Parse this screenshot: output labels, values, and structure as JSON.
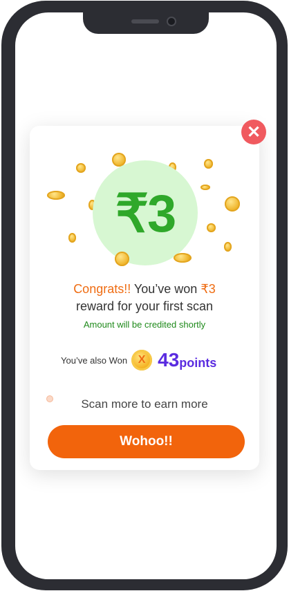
{
  "modal": {
    "hero_amount": "₹3",
    "headline_congrats": "Congrats!!",
    "headline_mid": " You’ve won ",
    "headline_amount": "₹3",
    "headline_line2": "reward for your first scan",
    "subtext": "Amount will be credited shortly",
    "also_won_label": "You’ve also Won",
    "points_coin_letter": "X",
    "points_value": "43",
    "points_unit": "points",
    "scan_more_text": "Scan more to earn more",
    "cta_label": "Wohoo!!",
    "close_glyph": "✕"
  },
  "icons": {
    "close": "close-icon",
    "coin": "coin-icon",
    "points_coin": "points-coin-icon"
  },
  "colors": {
    "accent_orange": "#f2640c",
    "success_green": "#2fa82a",
    "hero_circle": "#d7f7d2",
    "points_purple": "#5a2be0",
    "close_red": "#f05a5f"
  }
}
